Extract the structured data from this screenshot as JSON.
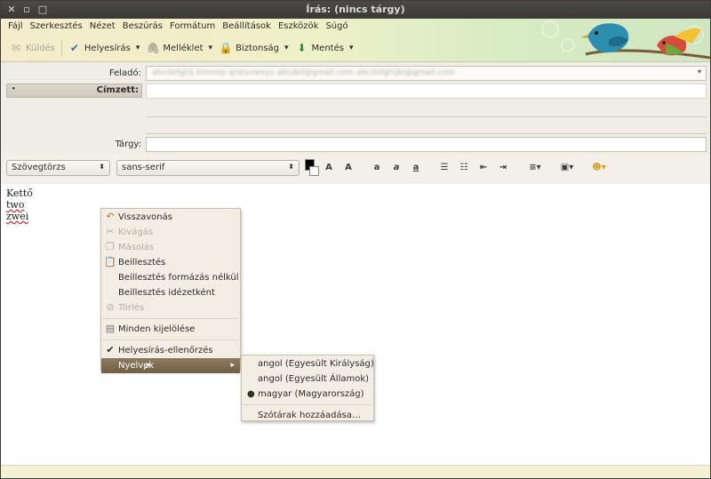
{
  "window": {
    "title": "Írás: (nincs tárgy)"
  },
  "menubar": {
    "items": [
      "Fájl",
      "Szerkesztés",
      "Nézet",
      "Beszúrás",
      "Formátum",
      "Beállítások",
      "Eszközök",
      "Súgó"
    ]
  },
  "toolbar": {
    "send_label": "Küldés",
    "spell_label": "Helyesírás",
    "attach_label": "Melléklet",
    "security_label": "Biztonság",
    "save_label": "Mentés"
  },
  "header_fields": {
    "from_label": "Feladó:",
    "from_value": "abcdefghij klmnop qrstuvwxyz abcdef@gmail.com  abcdefghijkl@gmail.com",
    "to_button": "Címzett:",
    "to_marker": "•",
    "subject_label": "Tárgy:",
    "subject_value": ""
  },
  "format_bar": {
    "paragraph_style": "Szövegtörzs",
    "font": "sans-serif"
  },
  "body": {
    "lines": [
      "Kettő",
      "two",
      "zwei"
    ]
  },
  "context_menu": {
    "items": [
      {
        "label": "Visszavonás",
        "enabled": true,
        "icon": "undo-icon"
      },
      {
        "label": "Kivágás",
        "enabled": false,
        "icon": "scissors-icon"
      },
      {
        "label": "Másolás",
        "enabled": false,
        "icon": "copy-icon"
      },
      {
        "label": "Beillesztés",
        "enabled": true,
        "icon": "paste-icon"
      },
      {
        "label": "Beillesztés formázás nélkül",
        "enabled": true
      },
      {
        "label": "Beillesztés idézetként",
        "enabled": true
      },
      {
        "label": "Törlés",
        "enabled": false,
        "icon": "delete-icon"
      },
      {
        "label": "Minden kijelölése",
        "enabled": true,
        "icon": "select-all-icon"
      },
      {
        "label": "Helyesírás-ellenőrzés",
        "enabled": true,
        "checked": true
      },
      {
        "label": "Nyelvek",
        "enabled": true,
        "submenu": true,
        "highlighted": true
      }
    ]
  },
  "language_submenu": {
    "items": [
      {
        "label": "angol (Egyesült Királyság)",
        "selected": false
      },
      {
        "label": "angol (Egyesült Államok)",
        "selected": false
      },
      {
        "label": "magyar (Magyarország)",
        "selected": true
      }
    ],
    "add_dictionaries": "Szótárak hozzáadása…"
  },
  "colors": {
    "highlight": "#7d6a4f",
    "menu_bg": "#f2eee4",
    "titlebar": "#3c3b37"
  }
}
